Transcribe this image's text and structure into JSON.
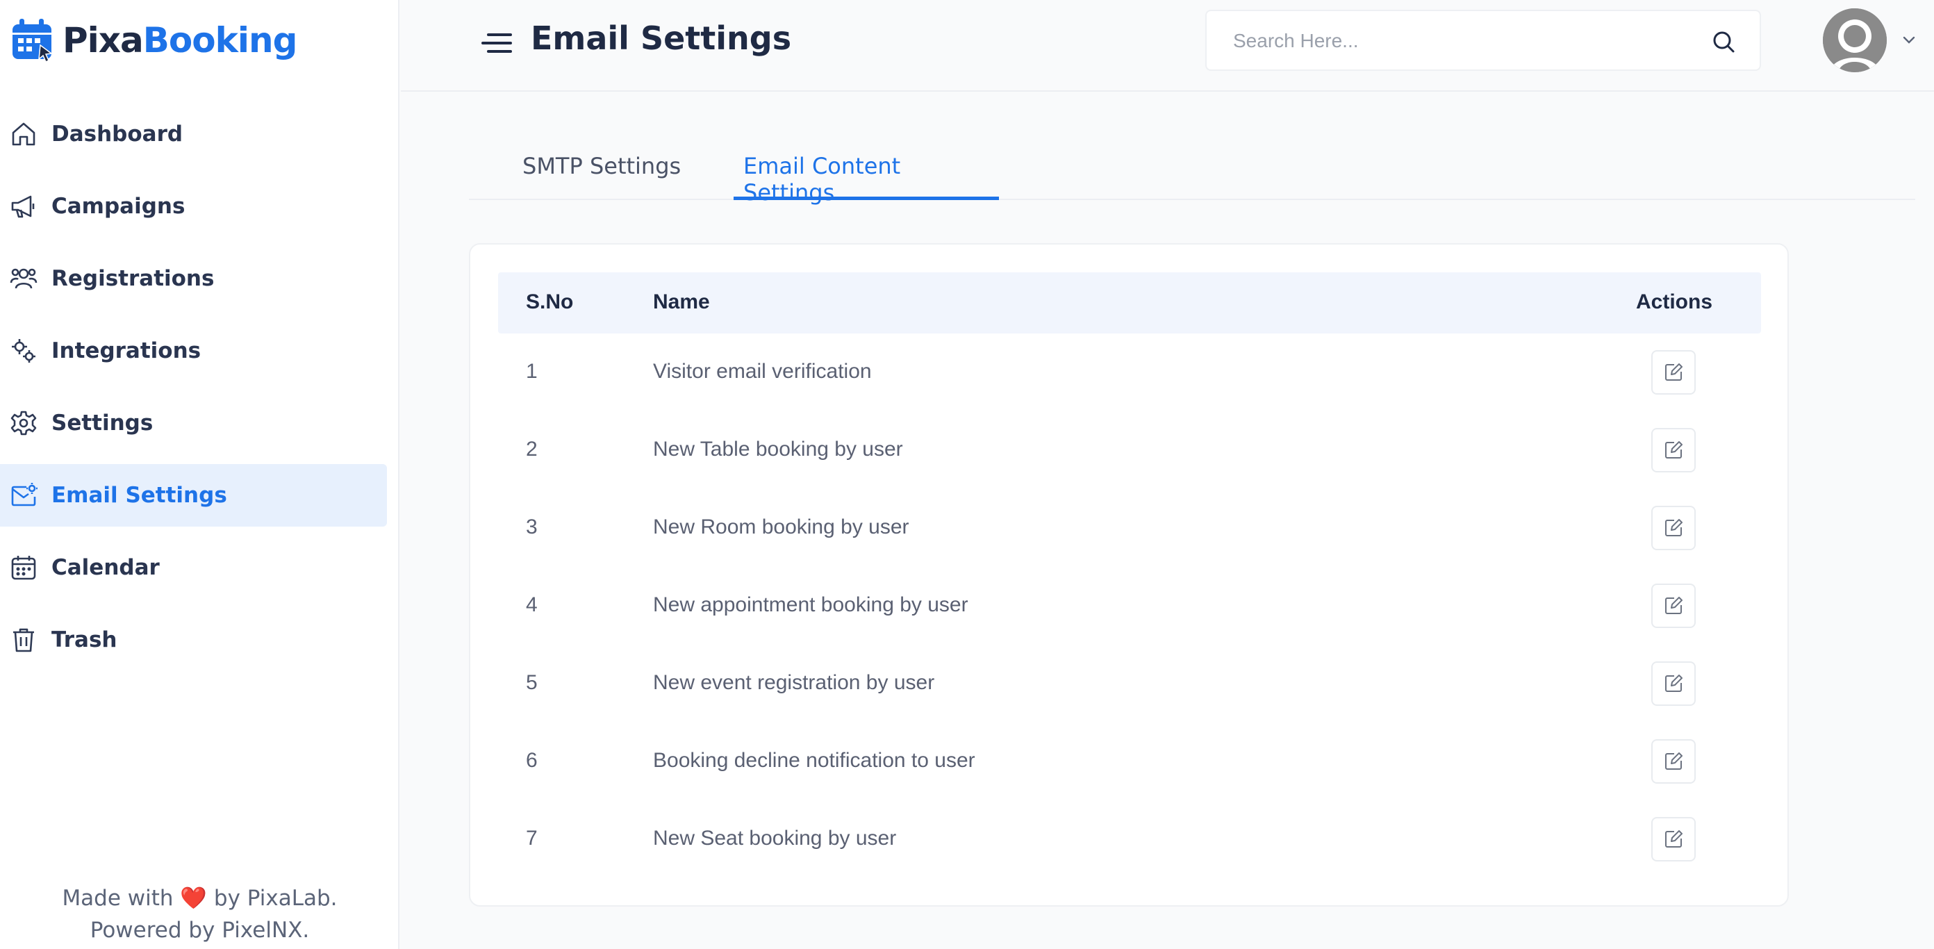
{
  "brand": {
    "part1": "Pixa",
    "part2": "Booking"
  },
  "sidebar": {
    "items": [
      {
        "label": "Dashboard",
        "icon": "home-icon"
      },
      {
        "label": "Campaigns",
        "icon": "megaphone-icon"
      },
      {
        "label": "Registrations",
        "icon": "users-icon"
      },
      {
        "label": "Integrations",
        "icon": "integration-gears-icon"
      },
      {
        "label": "Settings",
        "icon": "gear-icon"
      },
      {
        "label": "Email Settings",
        "icon": "mail-settings-icon",
        "active": true
      },
      {
        "label": "Calendar",
        "icon": "calendar-icon"
      },
      {
        "label": "Trash",
        "icon": "trash-icon"
      }
    ],
    "footer": {
      "line1_prefix": "Made with",
      "heart": "❤️",
      "line1_suffix": "by PixaLab.",
      "line2": "Powered by PixelNX."
    }
  },
  "header": {
    "title": "Email Settings",
    "search_placeholder": "Search Here..."
  },
  "tabs": [
    {
      "label": "SMTP Settings",
      "active": false
    },
    {
      "label": "Email Content Settings",
      "active": true
    }
  ],
  "table": {
    "headers": {
      "sno": "S.No",
      "name": "Name",
      "actions": "Actions"
    },
    "rows": [
      {
        "sno": "1",
        "name": "Visitor email verification"
      },
      {
        "sno": "2",
        "name": "New Table booking by user"
      },
      {
        "sno": "3",
        "name": "New Room booking by user"
      },
      {
        "sno": "4",
        "name": "New appointment booking by user"
      },
      {
        "sno": "5",
        "name": "New event registration by user"
      },
      {
        "sno": "6",
        "name": "Booking decline notification to user"
      },
      {
        "sno": "7",
        "name": "New Seat booking by user"
      }
    ]
  },
  "colors": {
    "accent": "#1e73e8",
    "active_bg": "#e7f0fd",
    "text_dark": "#1f2a44"
  }
}
